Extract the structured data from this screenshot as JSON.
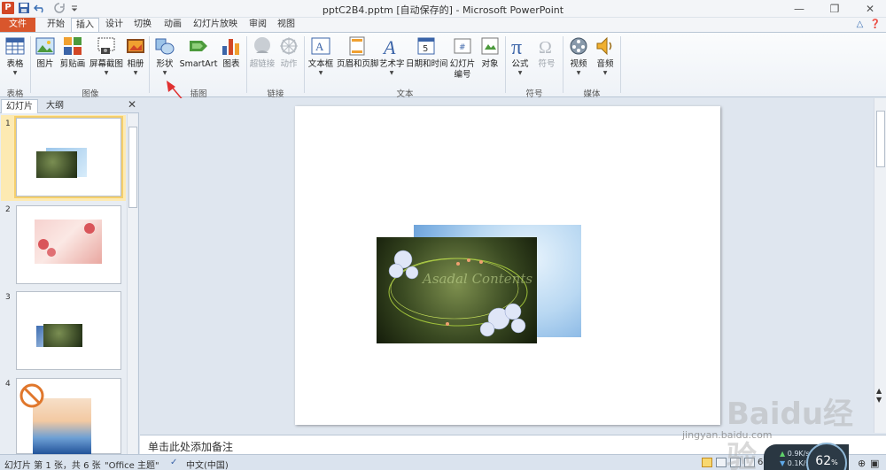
{
  "window": {
    "title": "pptC2B4.pptm [自动保存的] - Microsoft PowerPoint"
  },
  "quick_access": {
    "logo": "P",
    "icons": [
      "save-icon",
      "undo-icon",
      "redo-icon",
      "customize-icon"
    ]
  },
  "tabs": [
    "文件",
    "开始",
    "插入",
    "设计",
    "切换",
    "动画",
    "幻灯片放映",
    "审阅",
    "视图"
  ],
  "active_tab": "插入",
  "ribbon": {
    "groups": [
      {
        "label": "表格",
        "buttons": [
          {
            "label": "表格",
            "icon": "table-icon",
            "dropdown": true
          }
        ]
      },
      {
        "label": "图像",
        "buttons": [
          {
            "label": "图片",
            "icon": "picture-icon"
          },
          {
            "label": "剪贴画",
            "icon": "clipart-icon"
          },
          {
            "label": "屏幕截图",
            "icon": "screenshot-icon",
            "dropdown": true
          },
          {
            "label": "相册",
            "icon": "photo-album-icon",
            "dropdown": true
          }
        ]
      },
      {
        "label": "插图",
        "buttons": [
          {
            "label": "形状",
            "icon": "shapes-icon",
            "dropdown": true
          },
          {
            "label": "SmartArt",
            "icon": "smartart-icon"
          },
          {
            "label": "图表",
            "icon": "chart-icon"
          }
        ]
      },
      {
        "label": "链接",
        "buttons": [
          {
            "label": "超链接",
            "icon": "hyperlink-icon",
            "disabled": true
          },
          {
            "label": "动作",
            "icon": "action-icon",
            "disabled": true
          }
        ]
      },
      {
        "label": "文本",
        "buttons": [
          {
            "label": "文本框",
            "icon": "textbox-icon",
            "dropdown": true
          },
          {
            "label": "页眉和页脚",
            "icon": "header-footer-icon"
          },
          {
            "label": "艺术字",
            "icon": "wordart-icon",
            "dropdown": true
          },
          {
            "label": "日期和时间",
            "icon": "date-time-icon"
          },
          {
            "label": "幻灯片\n编号",
            "icon": "slide-number-icon"
          },
          {
            "label": "对象",
            "icon": "object-icon"
          }
        ]
      },
      {
        "label": "符号",
        "buttons": [
          {
            "label": "公式",
            "icon": "equation-icon",
            "dropdown": true
          },
          {
            "label": "符号",
            "icon": "symbol-icon",
            "disabled": true
          }
        ]
      },
      {
        "label": "媒体",
        "buttons": [
          {
            "label": "视频",
            "icon": "video-icon",
            "dropdown": true
          },
          {
            "label": "音频",
            "icon": "audio-icon",
            "dropdown": true
          }
        ]
      }
    ]
  },
  "left_pane": {
    "tabs": [
      "幻灯片",
      "大纲"
    ],
    "active_tab": "幻灯片",
    "slides": [
      "1",
      "2",
      "3",
      "4"
    ],
    "selected": "1"
  },
  "slide": {
    "image_text": "Asadal Contents"
  },
  "notes": {
    "placeholder": "单击此处添加备注"
  },
  "status": {
    "slide_info": "幻灯片 第 1 张，共 6 张",
    "theme": "\"Office 主题\"",
    "language": "中文(中国)",
    "zoom": "64"
  },
  "speed_widget": {
    "up": "0.9K/s",
    "down": "0.1K/s",
    "percent": "62",
    "unit": "%"
  },
  "watermark": {
    "brand": "Baidu经验",
    "url": "jingyan.baidu.com"
  },
  "colors": {
    "file_tab": "#d9562c",
    "arrow": "#e03030",
    "accent": "#2b579a"
  }
}
